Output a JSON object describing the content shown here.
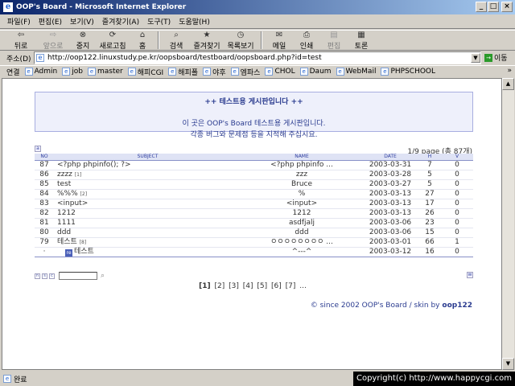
{
  "window": {
    "title": "OOP's Board - Microsoft Internet Explorer"
  },
  "menu": [
    "파일(F)",
    "편집(E)",
    "보기(V)",
    "즐겨찾기(A)",
    "도구(T)",
    "도움말(H)"
  ],
  "toolbar": {
    "back": "뒤로",
    "forward": "앞으로",
    "stop": "중지",
    "refresh": "새로고침",
    "home": "홈",
    "search": "검색",
    "favorites": "즐겨찾기",
    "history": "목록보기",
    "mail": "메일",
    "print": "인쇄",
    "edit": "편집",
    "discuss": "토론"
  },
  "address": {
    "label": "주소(D)",
    "url": "http://oop122.linuxstudy.pe.kr/oopsboard/testboard/oopsboard.php?id=test",
    "go": "이동"
  },
  "links": {
    "label": "연결",
    "items": [
      "Admin",
      "job",
      "master",
      "해피CGI",
      "해피폴",
      "야후",
      "엠파스",
      "CHOL",
      "Daum",
      "WebMail",
      "PHPSCHOOL"
    ]
  },
  "board": {
    "title": "++ 테스트용 게시판입니다 ++",
    "desc1": "이 곳은 OOP's Board 테스트용 게시판입니다.",
    "desc2": "각종 버그와 문제점 등을 지적해 주십시요.",
    "pageinfo": "1/9 page (총 87개)",
    "headers": {
      "no": "NO",
      "subject": "SUBJECT",
      "name": "NAME",
      "date": "DATE",
      "hits": "H",
      "votes": "V"
    },
    "rows": [
      {
        "no": "87",
        "subject": "<?php phpinfo(); ?>",
        "count": "",
        "name": "<?php phpinfo ...",
        "date": "2003-03-31",
        "hits": "7",
        "votes": "0"
      },
      {
        "no": "86",
        "subject": "zzzz",
        "count": "[1]",
        "name": "zzz",
        "date": "2003-03-28",
        "hits": "5",
        "votes": "0"
      },
      {
        "no": "85",
        "subject": "test",
        "count": "",
        "name": "Bruce",
        "date": "2003-03-27",
        "hits": "5",
        "votes": "0"
      },
      {
        "no": "84",
        "subject": "%%%",
        "count": "[2]",
        "name": "%",
        "date": "2003-03-13",
        "hits": "27",
        "votes": "0"
      },
      {
        "no": "83",
        "subject": "<input>",
        "count": "",
        "name": "<input>",
        "date": "2003-03-13",
        "hits": "17",
        "votes": "0"
      },
      {
        "no": "82",
        "subject": "1212",
        "count": "",
        "name": "1212",
        "date": "2003-03-13",
        "hits": "26",
        "votes": "0"
      },
      {
        "no": "81",
        "subject": "1111",
        "count": "",
        "name": "asdfjalj",
        "date": "2003-03-06",
        "hits": "23",
        "votes": "0"
      },
      {
        "no": "80",
        "subject": "ddd",
        "count": "",
        "name": "ddd",
        "date": "2003-03-06",
        "hits": "15",
        "votes": "0"
      },
      {
        "no": "79",
        "subject": "테스트",
        "count": "[8]",
        "name": "ㅇㅇㅇㅇㅇㅇㅇㅇ ...",
        "date": "2003-03-01",
        "hits": "66",
        "votes": "1"
      },
      {
        "no": "·",
        "subject": "테스트",
        "count": "",
        "name": "^---^",
        "date": "2003-03-12",
        "hits": "16",
        "votes": "0",
        "reply": true,
        "reply_icon": "re"
      }
    ],
    "pages": [
      "[1]",
      "[2]",
      "[3]",
      "[4]",
      "[5]",
      "[6]",
      "[7]",
      "..."
    ],
    "footer": {
      "prefix": "© since 2002 OOP's Board / skin by",
      "author": "oop122"
    }
  },
  "status": {
    "text": "완료"
  },
  "copyright": "Copyright(c) http://www.happycgi.com"
}
